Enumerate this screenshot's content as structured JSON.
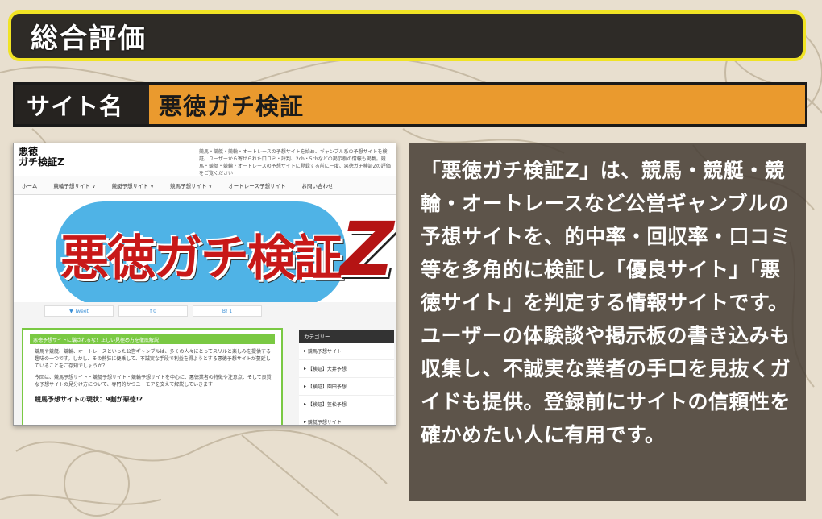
{
  "header": {
    "title": "総合評価"
  },
  "site": {
    "label": "サイト名",
    "name": "悪徳ガチ検証"
  },
  "thumbnail": {
    "logo_line1": "悪徳",
    "logo_line2": "ガチ検証Z",
    "description": "競馬・競艇・競輪・オートレースの予想サイトを始め、ギャンブル系の予想サイトを検証。ユーザーから寄せられた口コミ・評判、2ch・5chなどの掲示板の情報も掲載。競馬・競艇・競輪・オートレースの予想サイトに登録する前に一度、悪徳ガチ検証Zの評価をご覧ください",
    "nav": [
      "ホーム",
      "競輪予想サイト ∨",
      "競艇予想サイト ∨",
      "競馬予想サイト ∨",
      "オートレース予想サイト",
      "お問い合わせ"
    ],
    "hero_title": "悪徳ガチ検証",
    "hero_z": "Z",
    "share": [
      "Tweet",
      "0",
      "1"
    ],
    "main_head": "悪徳予想サイトに騙されるな！正しい見極め方を徹底解説",
    "main_p1": "競馬や競艇、競輪、オートレースといった公営ギャンブルは、多くの人々にとってスリルと楽しみを提供する趣味の一つです。しかし、その熱狂に便乗して、不誠実な手段で利益を得ようとする悪徳予想サイトが蔓延していることをご存知でしょうか？",
    "main_p2": "今回は、競馬予想サイト・競艇予想サイト・競輪予想サイトを中心に、悪徳業者の特徴や注意点、そして良質な予想サイトの見分け方について、専門的かつユーモアを交えて解説していきます！",
    "main_h": "競馬予想サイトの現状：9割が悪徳!?",
    "side_head": "カテゴリー",
    "side_items": [
      "競馬予想サイト",
      "【検証】大井予想",
      "【検証】園田予想",
      "【検証】笠松予想",
      "競艇予想サイト"
    ]
  },
  "description": "「悪徳ガチ検証Z」は、競馬・競艇・競輪・オートレースなど公営ギャンブルの予想サイトを、的中率・回収率・口コミ等を多角的に検証し「優良サイト」「悪徳サイト」を判定する情報サイトです。ユーザーの体験談や掲示板の書き込みも収集し、不誠実な業者の手口を見抜くガイドも提供。登録前にサイトの信頼性を確かめたい人に有用です。",
  "colors": {
    "accent_yellow": "#f0e324",
    "orange": "#ea9a2e",
    "dark": "#2e2b27"
  }
}
